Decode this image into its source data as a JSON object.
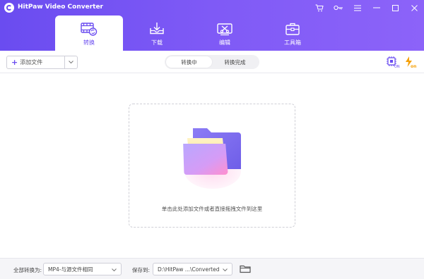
{
  "app": {
    "title": "HitPaw Video Converter"
  },
  "titlebar_icons": [
    "cart-icon",
    "key-icon",
    "menu-icon",
    "minimize-icon",
    "maximize-icon",
    "close-icon"
  ],
  "tabs": [
    {
      "id": "convert",
      "label": "转换",
      "icon": "convert-film-icon",
      "active": true
    },
    {
      "id": "download",
      "label": "下载",
      "icon": "download-icon",
      "active": false
    },
    {
      "id": "edit",
      "label": "编辑",
      "icon": "edit-icon",
      "active": false
    },
    {
      "id": "toolbox",
      "label": "工具箱",
      "icon": "toolbox-icon",
      "active": false
    }
  ],
  "toolbar": {
    "add_label": "添加文件",
    "segments": [
      {
        "label": "转换中",
        "active": true
      },
      {
        "label": "转换完成",
        "active": false
      }
    ]
  },
  "hw_accel": [
    "gpu-acceleration-icon",
    "lossless-speed-icon"
  ],
  "drop_zone": {
    "text": "单击此处添加文件或者直接拖拽文件到这里"
  },
  "bottom": {
    "convert_all_label": "全部转换为:",
    "format_value": "MP4-与源文件相同",
    "save_to_label": "保存到:",
    "save_path": "D:\\HitPaw ...\\Converted"
  },
  "colors": {
    "accent": "#6a4cf0",
    "accent_orange": "#f5a10a"
  }
}
